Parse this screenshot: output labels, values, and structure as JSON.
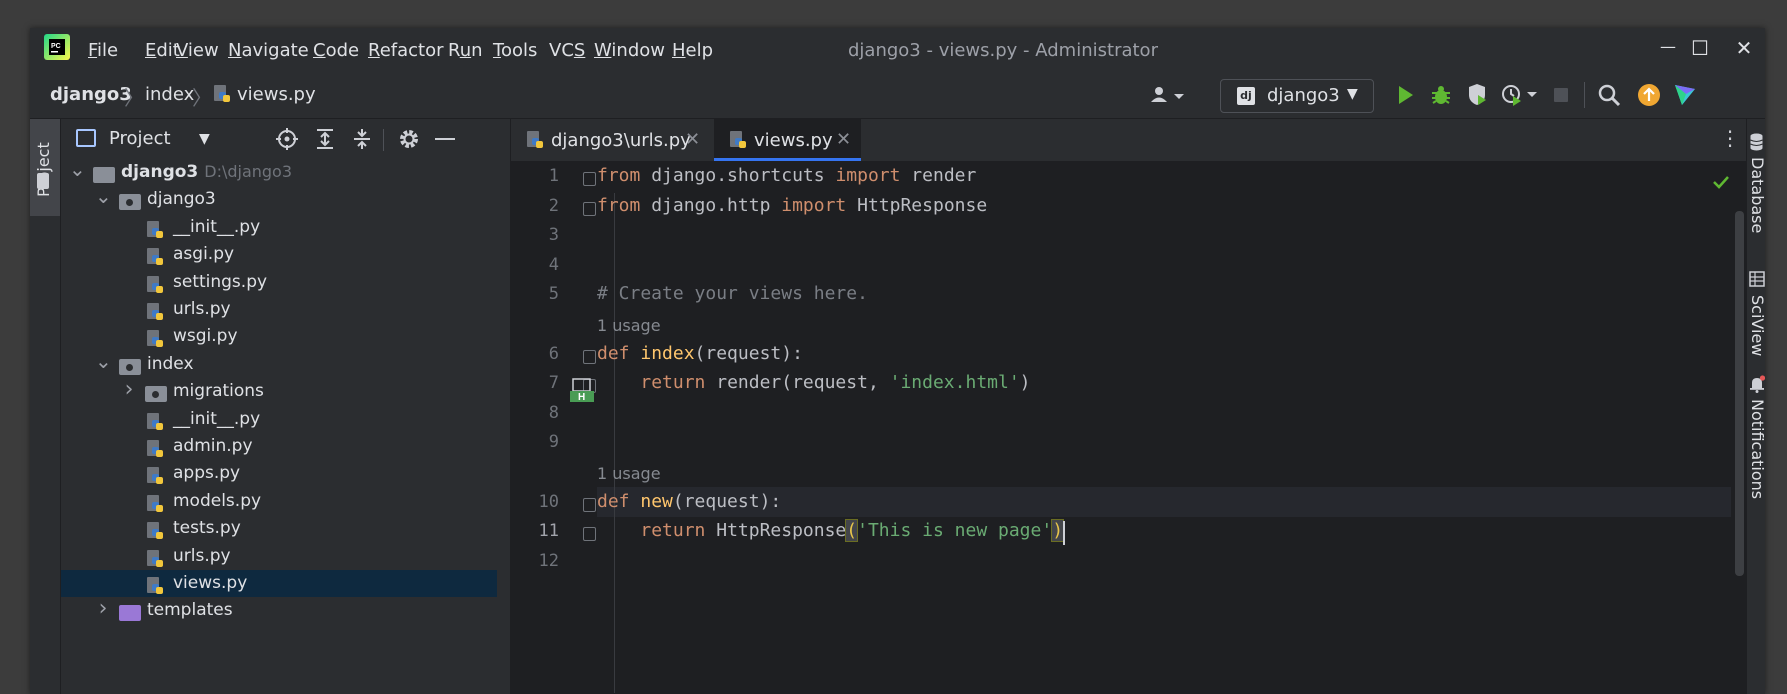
{
  "menu": {
    "items": [
      "File",
      "Edit",
      "View",
      "Navigate",
      "Code",
      "Refactor",
      "Run",
      "Tools",
      "VCS",
      "Window",
      "Help"
    ],
    "mnemonics": [
      "F",
      "E",
      "V",
      "N",
      "C",
      "R",
      "u",
      "T",
      "S",
      "W",
      "H"
    ]
  },
  "window": {
    "title": "django3 - views.py - Administrator",
    "controls": {
      "minimize": "—",
      "maximize": "☐",
      "close": "✕"
    }
  },
  "breadcrumb": [
    "django3",
    "index",
    "views.py"
  ],
  "run_config": {
    "badge": "dj",
    "name": "django3"
  },
  "project_panel": {
    "title": "Project",
    "tree": [
      {
        "label": "django3",
        "path": "D:\\django3",
        "type": "folder-root",
        "expanded": true
      },
      {
        "label": "django3",
        "type": "package",
        "expanded": true
      },
      {
        "label": "__init__.py",
        "type": "py"
      },
      {
        "label": "asgi.py",
        "type": "py"
      },
      {
        "label": "settings.py",
        "type": "py"
      },
      {
        "label": "urls.py",
        "type": "py"
      },
      {
        "label": "wsgi.py",
        "type": "py"
      },
      {
        "label": "index",
        "type": "package",
        "expanded": true
      },
      {
        "label": "migrations",
        "type": "package",
        "expanded": false
      },
      {
        "label": "__init__.py",
        "type": "py"
      },
      {
        "label": "admin.py",
        "type": "py"
      },
      {
        "label": "apps.py",
        "type": "py"
      },
      {
        "label": "models.py",
        "type": "py"
      },
      {
        "label": "tests.py",
        "type": "py"
      },
      {
        "label": "urls.py",
        "type": "py"
      },
      {
        "label": "views.py",
        "type": "py",
        "selected": true
      },
      {
        "label": "templates",
        "type": "templates",
        "expanded": false
      }
    ]
  },
  "left_strip": {
    "project_tab": "Project"
  },
  "editor": {
    "tabs": [
      {
        "label": "django3\\urls.py",
        "active": false
      },
      {
        "label": "views.py",
        "active": true
      }
    ],
    "line_numbers": [
      "1",
      "2",
      "3",
      "4",
      "5",
      "6",
      "7",
      "8",
      "9",
      "10",
      "11",
      "12"
    ],
    "current_line": "11",
    "code_lines": [
      [
        [
          "kw",
          "from"
        ],
        [
          "t",
          " django.shortcuts "
        ],
        [
          "kw",
          "import"
        ],
        [
          "t",
          " render"
        ]
      ],
      [
        [
          "kw",
          "from"
        ],
        [
          "t",
          " django.http "
        ],
        [
          "kw",
          "import"
        ],
        [
          "t",
          " HttpResponse"
        ]
      ],
      [],
      [],
      [
        [
          "cmt",
          "# Create your views here."
        ]
      ],
      [
        [
          "kw",
          "def"
        ],
        [
          "t",
          " "
        ],
        [
          "fndef",
          "index"
        ],
        [
          "t",
          "(request):"
        ]
      ],
      [
        [
          "t",
          "    "
        ],
        [
          "kw",
          "return"
        ],
        [
          "t",
          " render(request, "
        ],
        [
          "str",
          "'index.html'"
        ],
        [
          "t",
          ")"
        ]
      ],
      [],
      [],
      [
        [
          "kw",
          "def"
        ],
        [
          "t",
          " "
        ],
        [
          "fndef",
          "new"
        ],
        [
          "t",
          "(request):"
        ]
      ],
      [
        [
          "t",
          "    "
        ],
        [
          "kw",
          "return"
        ],
        [
          "t",
          " HttpResponse"
        ],
        [
          "br",
          "("
        ],
        [
          "str",
          "'This is new page'"
        ],
        [
          "br",
          ")"
        ]
      ],
      []
    ],
    "usage_hint": "1 usage",
    "gutter_marker": "H"
  },
  "right_strip": {
    "labels": [
      "Database",
      "SciView",
      "Notifications"
    ]
  },
  "colors": {
    "keyword": "#cf8e6d",
    "function_def": "#ffc66d",
    "string": "#6aab73",
    "comment": "#7a7e85",
    "accent": "#3574f0",
    "run_green": "#5fb832",
    "update_orange": "#f0a732"
  }
}
